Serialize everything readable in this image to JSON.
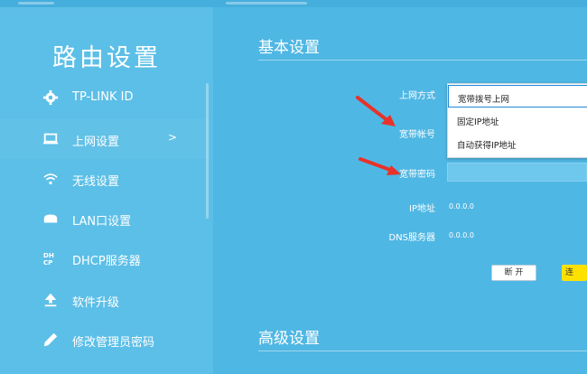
{
  "sidebar": {
    "title": "路由设置",
    "items": [
      {
        "label": "TP-LINK ID",
        "icon": "gear-icon"
      },
      {
        "label": "上网设置",
        "icon": "laptop-icon",
        "chevron": ">"
      },
      {
        "label": "无线设置",
        "icon": "wifi-icon"
      },
      {
        "label": "LAN口设置",
        "icon": "lan-icon"
      },
      {
        "label": "DHCP服务器",
        "icon": "dhcp-icon"
      },
      {
        "label": "软件升级",
        "icon": "upload-icon"
      },
      {
        "label": "修改管理员密码",
        "icon": "pencil-icon"
      }
    ]
  },
  "main": {
    "basic_title": "基本设置",
    "advanced_title": "高级设置",
    "form": {
      "connection_type_label": "上网方式",
      "account_label": "宽带帐号",
      "password_label": "宽带密码",
      "ip_label": "IP地址",
      "ip_value": "0.0.0.0",
      "dns_label": "DNS服务器",
      "dns_value": "0.0.0.0"
    },
    "dropdown_options": [
      "宽带拨号上网",
      "固定IP地址",
      "自动获得IP地址"
    ],
    "buttons": {
      "disconnect": "断 开",
      "connect": "连"
    }
  },
  "colors": {
    "background": "#4db5e2",
    "sidebar": "#5cbfe7",
    "accent_yellow": "#ffe100",
    "annotation_arrow": "#e8322a"
  }
}
